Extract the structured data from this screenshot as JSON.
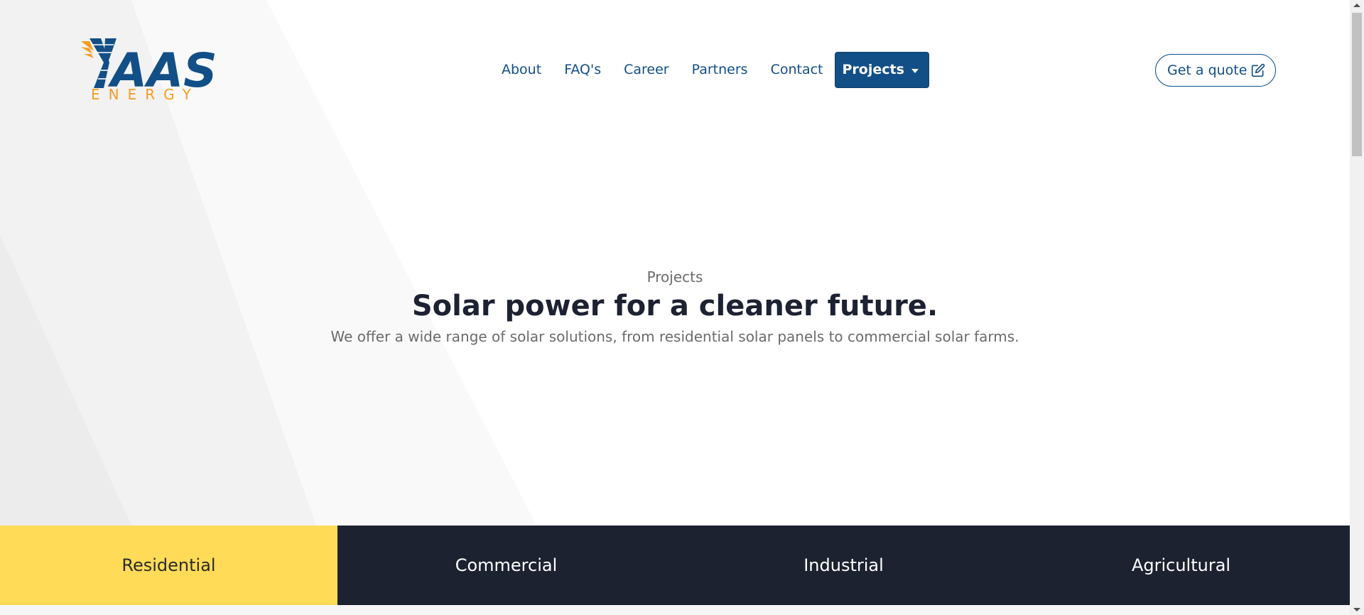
{
  "brand": {
    "logo_name": "AAS",
    "logo_sub": "ENERGY",
    "primary_color": "#124f86",
    "accent_color": "#f59c1f"
  },
  "nav": {
    "items": [
      {
        "label": "About"
      },
      {
        "label": "FAQ's"
      },
      {
        "label": "Career"
      },
      {
        "label": "Partners"
      },
      {
        "label": "Contact"
      }
    ],
    "dropdown_label": "Projects"
  },
  "header": {
    "quote_label": "Get a quote",
    "quote_icon": "edit-icon"
  },
  "hero": {
    "kicker": "Projects",
    "title": "Solar power for a cleaner future.",
    "subtitle": "We offer a wide range of solar solutions, from residential solar panels to commercial solar farms."
  },
  "tabs": {
    "items": [
      {
        "label": "Residential"
      },
      {
        "label": "Commercial"
      },
      {
        "label": "Industrial"
      },
      {
        "label": "Agricultural"
      }
    ],
    "active_color": "#ffdb57",
    "inactive_color": "#1d2230"
  }
}
